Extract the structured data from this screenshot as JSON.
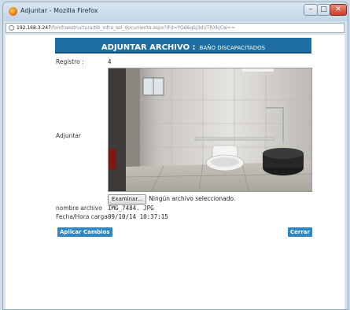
{
  "window": {
    "title": "Adjuntar - Mozilla Firefox",
    "url_host": "192.168.3.247",
    "url_path": "/foinfraestructura/tib_infra_sol_documento.aspx?IFd=YOd6qSJ3dUTRXkjCw=="
  },
  "header": {
    "title": "ADJUNTAR ARCHIVO :",
    "subtitle": "BAÑO DISCAPACITADOS"
  },
  "form": {
    "registro_label": "Registro :",
    "registro_value": "4",
    "adjuntar_label": "Adjuntar",
    "browse_button": "Examinar...",
    "file_status": "Ningún archivo seleccionado.",
    "nombre_label": "nombre archivo",
    "nombre_value": "IMG_7484. JPG",
    "fecha_label": "Fecha/Hora carga",
    "fecha_value": "09/10/14  10:37:15"
  },
  "actions": {
    "apply": "Aplicar Cambios",
    "close": "Cerrar"
  },
  "colors": {
    "header_bg": "#1d6fa3",
    "button_bg": "#2f86c5"
  },
  "icons": {
    "browser": "firefox-icon",
    "page": "page-icon",
    "minimize": "minimize-icon",
    "maximize": "maximize-icon",
    "close": "close-icon"
  }
}
